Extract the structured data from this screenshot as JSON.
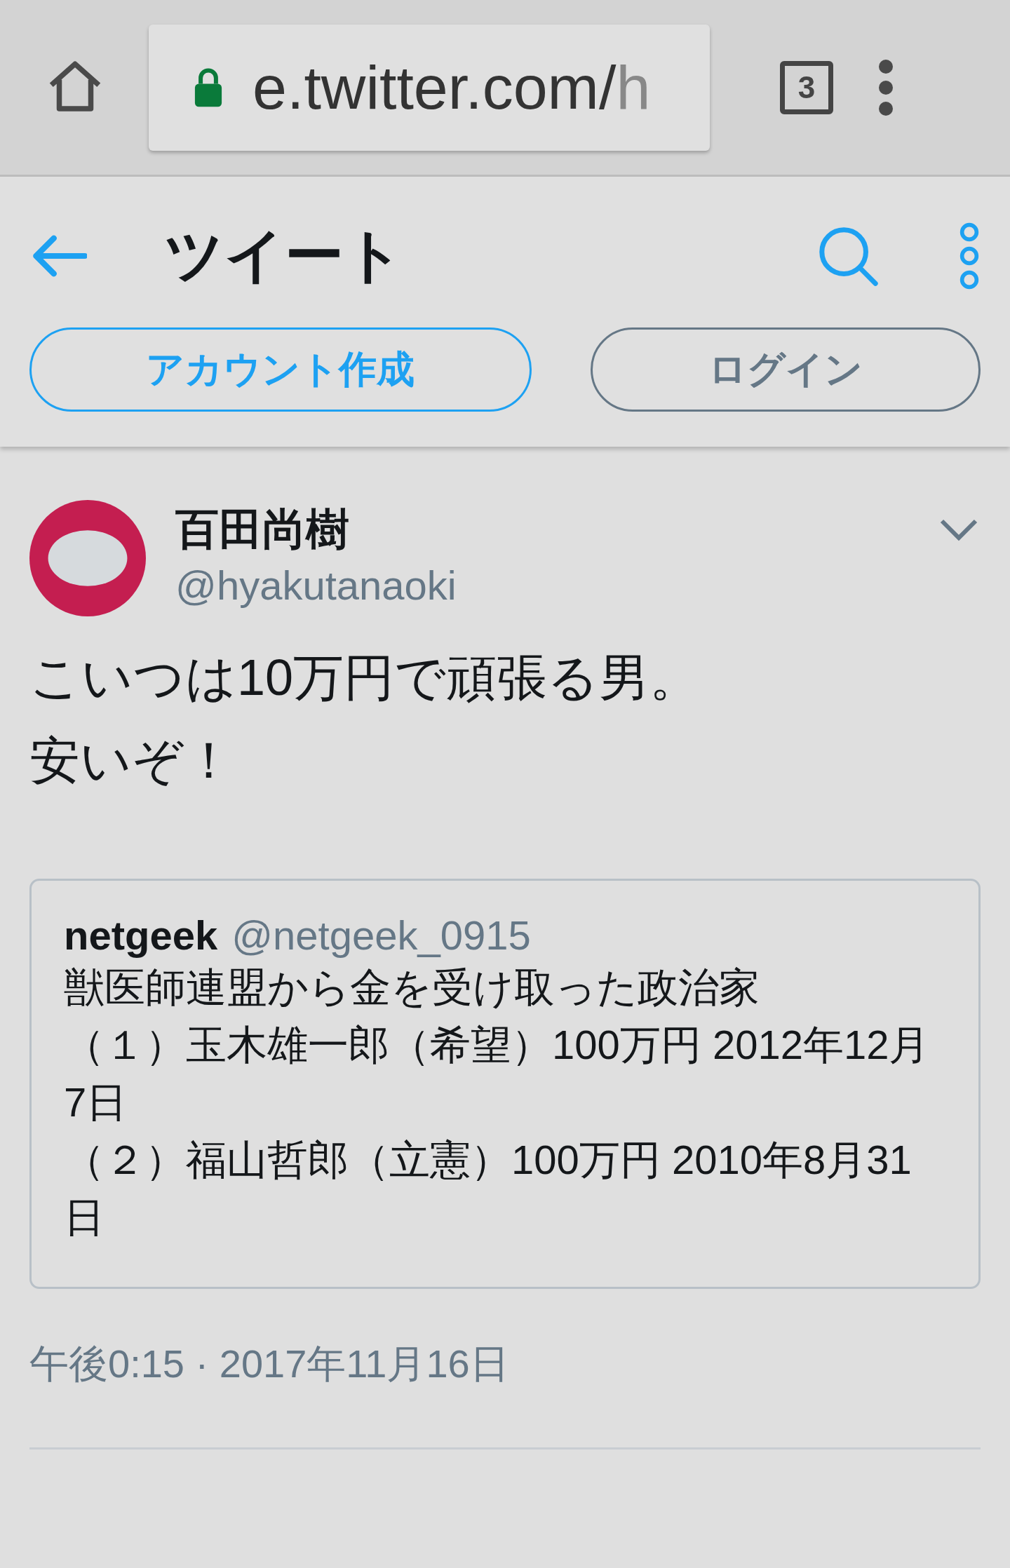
{
  "browser": {
    "url": "e.twitter.com/",
    "url_tail": "h",
    "tab_count": "3",
    "secure": true
  },
  "header": {
    "title": "ツイート"
  },
  "actions": [
    {
      "label": "アカウント作成",
      "kind": "primary"
    },
    {
      "label": "ログイン",
      "kind": "secondary"
    }
  ],
  "tweet": {
    "name": "百田尚樹",
    "handle": "@hyakutanaoki",
    "text_lines": [
      "こいつは10万円で頑張る男。",
      "安いぞ！"
    ],
    "quote": {
      "name": "netgeek",
      "handle": "@netgeek_0915",
      "lines": [
        "獣医師連盟から金を受け取った政治家",
        "（１）玉木雄一郎（希望）100万円 2012年12月7日",
        "（２）福山哲郎（立憲）100万円 2010年8月31日"
      ]
    },
    "timestamp": "午後0:15 · 2017年11月16日"
  }
}
